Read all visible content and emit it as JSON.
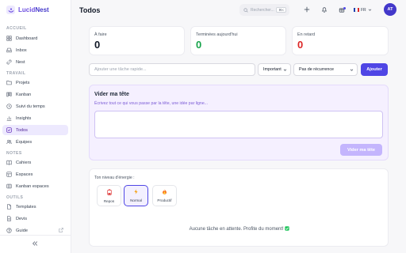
{
  "app": {
    "brand_part1": "Lucid",
    "brand_part2": "Nest"
  },
  "sidebar": {
    "sections": [
      {
        "label": "ACCUEIL"
      },
      {
        "label": "TRAVAIL"
      },
      {
        "label": "NOTES"
      },
      {
        "label": "OUTILS"
      }
    ],
    "items": [
      {
        "label": "Dashboard",
        "icon": "grid-icon"
      },
      {
        "label": "Inbox",
        "icon": "inbox-icon"
      },
      {
        "label": "Nest",
        "icon": "link-icon"
      },
      {
        "label": "Projets",
        "icon": "folder-icon"
      },
      {
        "label": "Kanban",
        "icon": "kanban-icon"
      },
      {
        "label": "Suivi du temps",
        "icon": "clock-icon"
      },
      {
        "label": "Insights",
        "icon": "chart-icon"
      },
      {
        "label": "Todos",
        "icon": "checkbox-icon"
      },
      {
        "label": "Équipes",
        "icon": "users-icon"
      },
      {
        "label": "Cahiers",
        "icon": "notebook-icon"
      },
      {
        "label": "Espaces",
        "icon": "spaces-icon"
      },
      {
        "label": "Kanban espaces",
        "icon": "board-icon"
      },
      {
        "label": "Templates",
        "icon": "template-icon"
      },
      {
        "label": "Devis",
        "icon": "document-icon"
      },
      {
        "label": "Guide",
        "icon": "help-icon"
      }
    ],
    "active": "Todos",
    "collapse_icon": "chevrons-left-icon"
  },
  "header": {
    "title": "Todos",
    "search_placeholder": "Rechercher...",
    "search_shortcut": "⌘K",
    "language": "FR",
    "avatar_initials": "AT"
  },
  "stats": [
    {
      "label": "À faire",
      "value": "0",
      "color": "#111827"
    },
    {
      "label": "Terminées aujourd'hui",
      "value": "0",
      "color": "#16a34a"
    },
    {
      "label": "En retard",
      "value": "0",
      "color": "#dc2626"
    }
  ],
  "quick_add": {
    "placeholder": "Ajouter une tâche rapide...",
    "priority": "Important",
    "recurrence": "Pas de récurrence",
    "submit": "Ajouter"
  },
  "brain_dump": {
    "title": "Vider ma tête",
    "subtitle": "Écrivez tout ce qui vous passe par la tête, une idée par ligne...",
    "button": "Vider ma tête"
  },
  "energy": {
    "label": "Ton niveau d'énergie :",
    "options": [
      {
        "label": "Repos",
        "icon": "🪫"
      },
      {
        "label": "Normal",
        "icon": "⚡"
      },
      {
        "label": "Productif",
        "icon": "🔥"
      }
    ],
    "selected": "Normal",
    "empty_message": "Aucune tâche en attente. Profite du moment!"
  },
  "colors": {
    "accent": "#4f46e5",
    "brand": "#6d4fe0",
    "success": "#16a34a",
    "danger": "#dc2626"
  }
}
